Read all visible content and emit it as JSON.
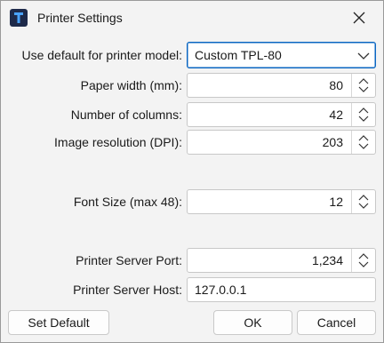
{
  "window": {
    "title": "Printer Settings",
    "close_label": "×"
  },
  "fields": {
    "printer_model": {
      "label": "Use default for printer model:",
      "value": "Custom TPL-80"
    },
    "paper_width": {
      "label": "Paper width (mm):",
      "value": "80"
    },
    "columns": {
      "label": "Number of columns:",
      "value": "42"
    },
    "resolution": {
      "label": "Image resolution (DPI):",
      "value": "203"
    },
    "font_size": {
      "label": "Font Size (max 48):",
      "value": "12"
    },
    "server_port": {
      "label": "Printer Server Port:",
      "value": "1,234"
    },
    "server_host": {
      "label": "Printer Server Host:",
      "value": "127.0.0.1"
    }
  },
  "buttons": {
    "set_default": "Set Default",
    "ok": "OK",
    "cancel": "Cancel"
  },
  "colors": {
    "focus_border": "#0a66c2",
    "app_icon_bg": "#1e2a4a",
    "app_icon_fg": "#4aa3ff"
  },
  "icons": {
    "app": "printer-app-icon",
    "close": "close-icon",
    "dropdown": "chevron-down-icon",
    "spin": "spin-up-down-icon"
  }
}
